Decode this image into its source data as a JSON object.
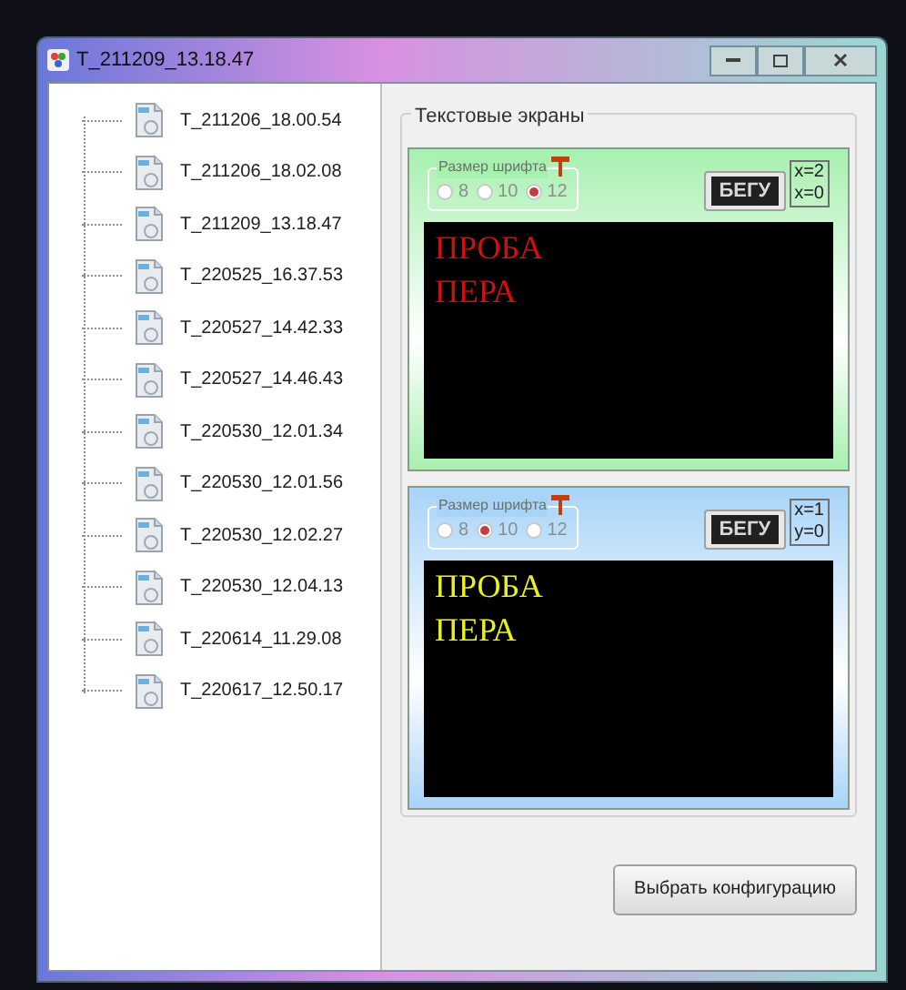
{
  "window": {
    "title": "T_211209_13.18.47"
  },
  "tree": {
    "items": [
      {
        "label": "T_211206_18.00.54"
      },
      {
        "label": "T_211206_18.02.08"
      },
      {
        "label": "T_211209_13.18.47"
      },
      {
        "label": "T_220525_16.37.53"
      },
      {
        "label": "T_220527_14.42.33"
      },
      {
        "label": "T_220527_14.46.43"
      },
      {
        "label": "T_220530_12.01.34"
      },
      {
        "label": "T_220530_12.01.56"
      },
      {
        "label": "T_220530_12.02.27"
      },
      {
        "label": "T_220530_12.04.13"
      },
      {
        "label": "T_220614_11.29.08"
      },
      {
        "label": "T_220617_12.50.17"
      }
    ]
  },
  "group": {
    "title": "Текстовые экраны"
  },
  "screens": [
    {
      "color": "#a8f0b0",
      "font_size_label": "Размер шрифта",
      "sizes": [
        {
          "label": "8",
          "selected": false
        },
        {
          "label": "10",
          "selected": false
        },
        {
          "label": "12",
          "selected": true
        }
      ],
      "run_button": "БЕГУ",
      "coords": [
        "x=2",
        "x=0"
      ],
      "lines": [
        {
          "text": "ПРОБА",
          "color": "#d01010"
        },
        {
          "text": "ПЕРА",
          "color": "#d01010"
        }
      ]
    },
    {
      "color": "#a8d4f8",
      "font_size_label": "Размер шрифта",
      "sizes": [
        {
          "label": "8",
          "selected": false
        },
        {
          "label": "10",
          "selected": true
        },
        {
          "label": "12",
          "selected": false
        }
      ],
      "run_button": "БЕГУ",
      "coords": [
        "x=1",
        "y=0"
      ],
      "lines": [
        {
          "text": "ПРОБА",
          "color": "#e8f020"
        },
        {
          "text": "ПЕРА",
          "color": "#e8f020"
        }
      ]
    }
  ],
  "buttons": [
    {
      "label": "Выбрать конфигурацию"
    }
  ]
}
